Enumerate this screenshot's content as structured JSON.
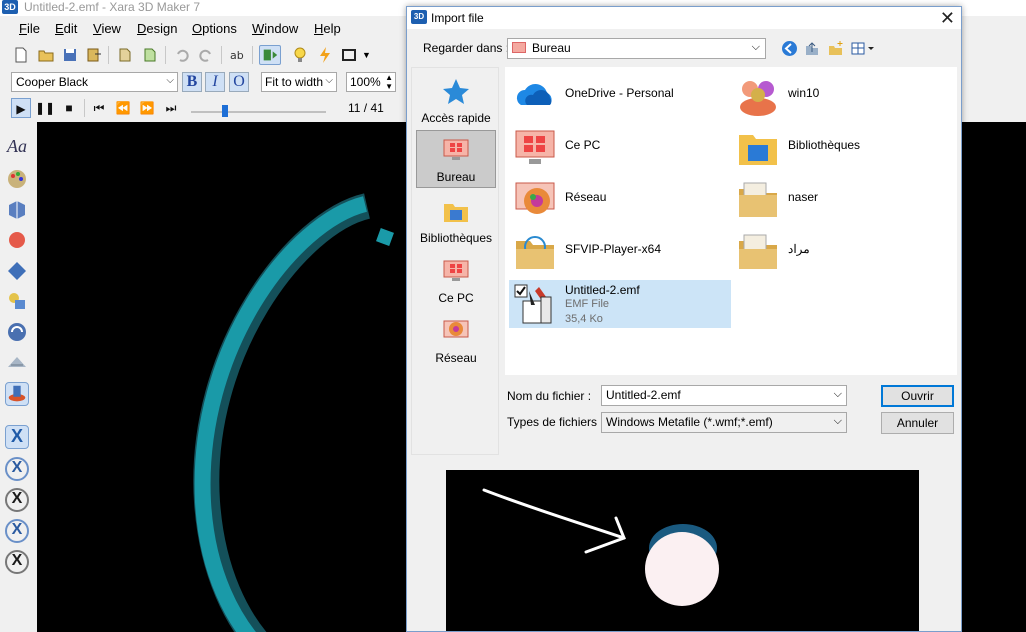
{
  "window": {
    "title": "Untitled-2.emf - Xara 3D Maker 7",
    "app_icon": "3D"
  },
  "menu": [
    {
      "label": "File",
      "key": "F",
      "rest": "ile"
    },
    {
      "label": "Edit",
      "key": "E",
      "rest": "dit"
    },
    {
      "label": "View",
      "key": "V",
      "rest": "iew"
    },
    {
      "label": "Design",
      "key": "D",
      "rest": "esign"
    },
    {
      "label": "Options",
      "key": "O",
      "rest": "ptions"
    },
    {
      "label": "Window",
      "key": "W",
      "rest": "indow"
    },
    {
      "label": "Help",
      "key": "H",
      "rest": "elp"
    }
  ],
  "format_bar": {
    "font": "Cooper Black",
    "bold": "B",
    "italic": "I",
    "outline": "O",
    "zoom_mode": "Fit to width",
    "zoom_percent": "100%"
  },
  "animation": {
    "frame_counter": "11 / 41",
    "position_fraction": 0.25
  },
  "dialog": {
    "title": "Import file",
    "close_glyph": "✕",
    "look_in_label": "Regarder dans :",
    "look_in_value": "Bureau",
    "places": [
      {
        "label": "Accès rapide",
        "icon": "star-icon"
      },
      {
        "label": "Bureau",
        "icon": "desktop-icon"
      },
      {
        "label": "Bibliothèques",
        "icon": "libraries-folder-icon"
      },
      {
        "label": "Ce PC",
        "icon": "pc-icon"
      },
      {
        "label": "Réseau",
        "icon": "network-icon"
      }
    ],
    "files": [
      {
        "name": "OneDrive - Personal",
        "icon": "onedrive-cloud-icon"
      },
      {
        "name": "win10",
        "icon": "user-folder-icon"
      },
      {
        "name": "Ce PC",
        "icon": "pc-icon"
      },
      {
        "name": "Bibliothèques",
        "icon": "libraries-folder-icon"
      },
      {
        "name": "Réseau",
        "icon": "network-icon"
      },
      {
        "name": "naser",
        "icon": "folder-icon"
      },
      {
        "name": "SFVIP-Player-x64",
        "icon": "folder-icon"
      },
      {
        "name": "مراد",
        "icon": "folder-icon"
      },
      {
        "name": "Untitled-2.emf",
        "type": "EMF File",
        "size": "35,4 Ko",
        "icon": "emf-file-icon"
      }
    ],
    "file_name_label": "Nom du fichier :",
    "file_name_value": "Untitled-2.emf",
    "file_type_label": "Types de fichiers :",
    "file_type_value": "Windows Metafile (*.wmf;*.emf)",
    "open_button": "Ouvrir",
    "cancel_button": "Annuler"
  },
  "colors": {
    "accent": "#0078d7",
    "selection": "#cce4f7",
    "canvas": "#000000",
    "ring": "#1a9aa8",
    "preview_circle": "#fbf0f2"
  }
}
